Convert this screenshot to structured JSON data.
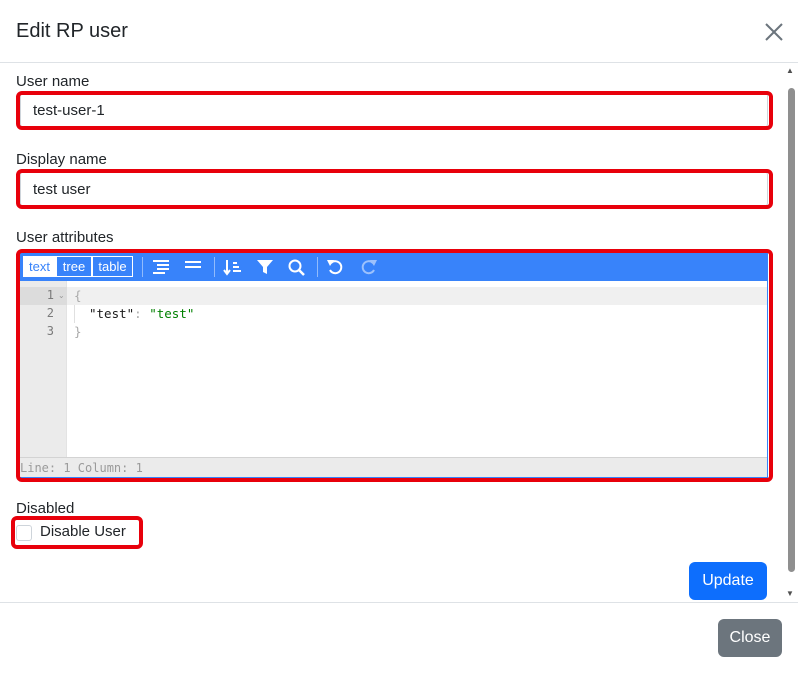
{
  "modal": {
    "title": "Edit RP user"
  },
  "form": {
    "user_name": {
      "label": "User name",
      "value": "test-user-1"
    },
    "display_name": {
      "label": "Display name",
      "value": "test user"
    },
    "user_attributes": {
      "label": "User attributes"
    },
    "disabled": {
      "label": "Disabled",
      "checkbox_label": "Disable User",
      "checked": false
    }
  },
  "editor": {
    "modes": [
      "text",
      "tree",
      "table"
    ],
    "active_mode": "text",
    "toolbar_icons": [
      "format-icon",
      "compact-icon",
      "sort-icon",
      "filter-icon",
      "search-icon",
      "undo-icon",
      "redo-icon"
    ],
    "line_numbers": [
      "1",
      "2",
      "3"
    ],
    "lines": {
      "open_brace": "{",
      "key": "\"test\"",
      "colon": ": ",
      "value": "\"test\"",
      "close_brace": "}"
    },
    "status": "Line: 1  Column: 1",
    "accent_color": "#3883fa"
  },
  "buttons": {
    "update": "Update",
    "close": "Close"
  },
  "colors": {
    "primary": "#0d6efd",
    "secondary": "#6c757d",
    "highlight": "#e8000b"
  }
}
